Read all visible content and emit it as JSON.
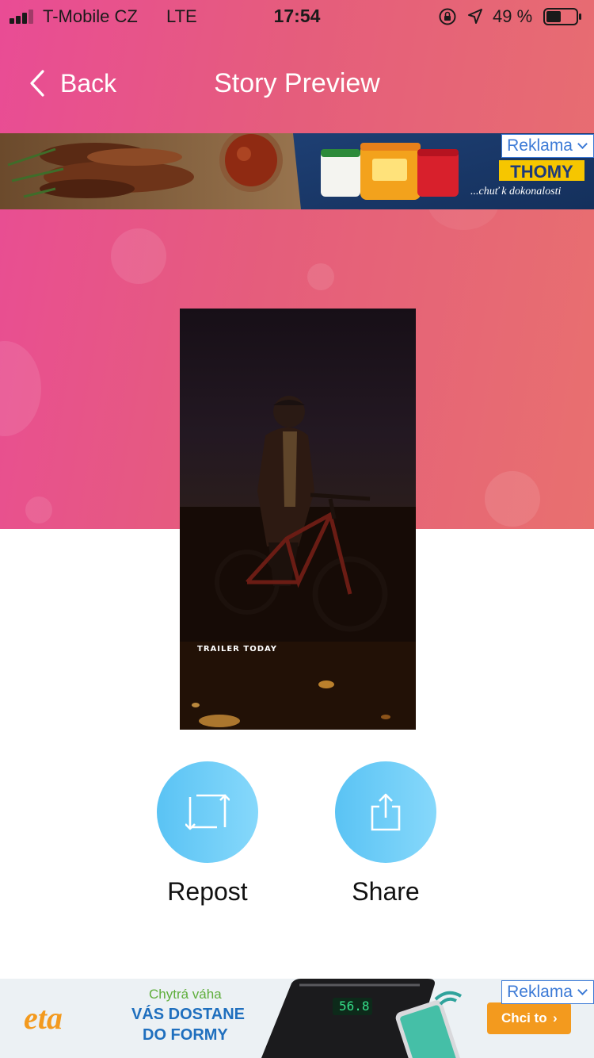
{
  "status_bar": {
    "carrier": "T-Mobile CZ",
    "network": "LTE",
    "time": "17:54",
    "battery": "49 %",
    "battery_level": 0.49,
    "icons": [
      "signal-icon",
      "orientation-lock-icon",
      "location-icon",
      "battery-icon"
    ]
  },
  "nav": {
    "back_label": "Back",
    "title": "Story Preview"
  },
  "ads": {
    "top": {
      "label": "Reklama",
      "brand": "THOMY",
      "tagline": "...chuť k dokonalosti"
    },
    "bottom": {
      "label": "Reklama",
      "brand": "eta",
      "small_line": "Chytrá váha",
      "headline_1": "VÁS DOSTANE",
      "headline_2": "DO FORMY",
      "cta": "Chci to",
      "scale_reading": "56.8"
    }
  },
  "story": {
    "caption": "TRAILER TODAY"
  },
  "actions": {
    "repost_label": "Repost",
    "share_label": "Share"
  },
  "colors": {
    "header_gradient_start": "#e94c95",
    "header_gradient_end": "#e8706f",
    "action_button": "#5ac3f4",
    "ad_label": "#3c7ad6",
    "eta_orange": "#f39a1e"
  }
}
